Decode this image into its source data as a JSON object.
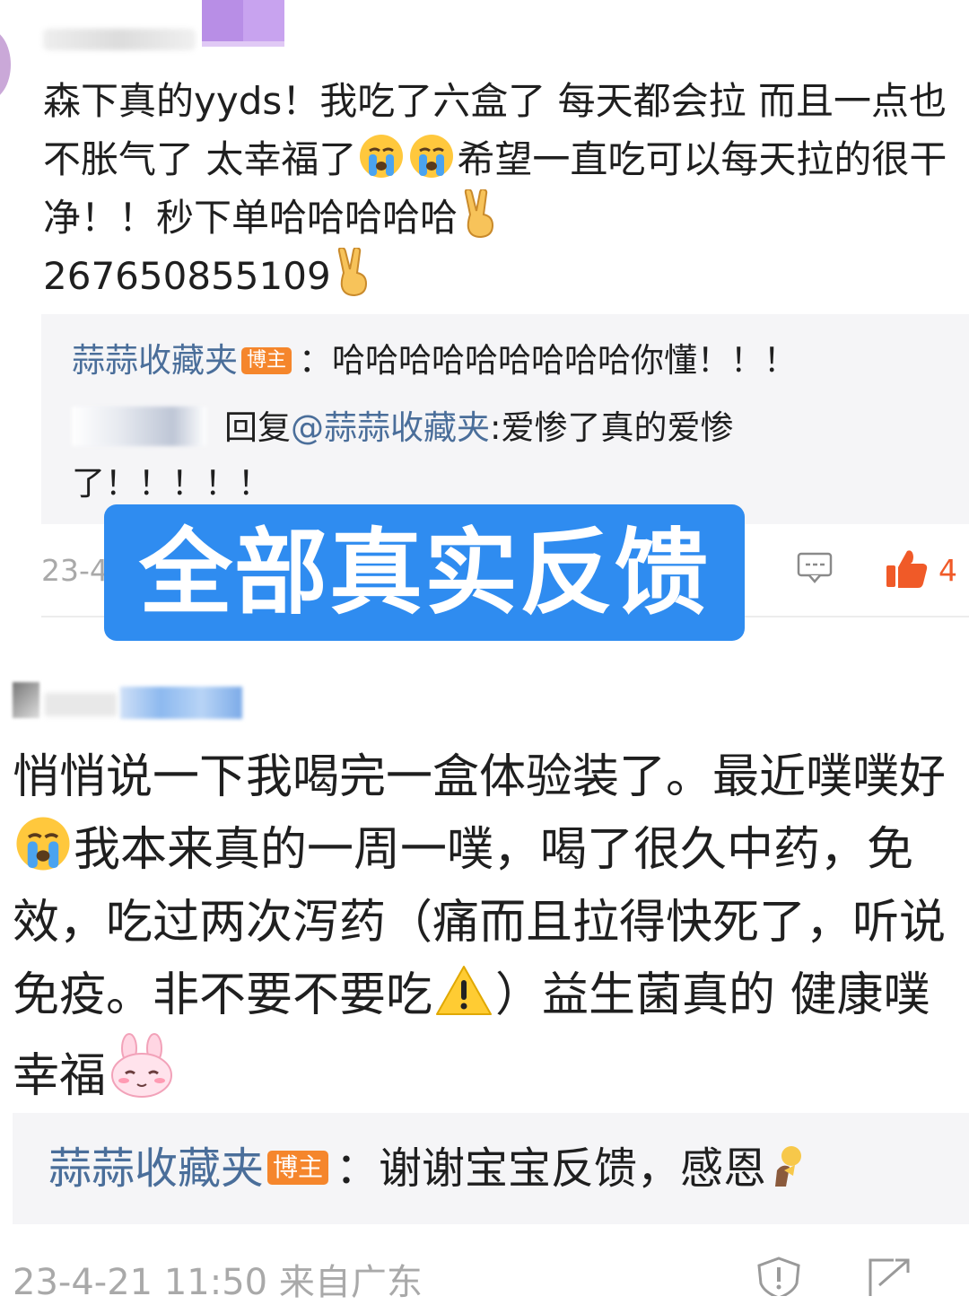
{
  "comment1": {
    "text_part1": "森下真的yyds！我吃了六盒了 每天都会拉 而且一点也不胀气了 太幸福了",
    "text_part2": "希望一直吃可以每天拉的很干净！！秒下单哈哈哈哈哈",
    "order_number": "267650855109",
    "emojis": [
      "crying-emoji",
      "crying-emoji",
      "victory-hand-emoji",
      "victory-hand-emoji"
    ],
    "reply1": {
      "author": "蒜蒜收藏夹",
      "tag": "博主",
      "text": "：哈哈哈哈哈哈哈哈哈你懂！！！"
    },
    "reply2": {
      "prefix": "回复",
      "mention": "@蒜蒜收藏夹",
      "text": ":爱惨了真的爱惨了！！！！！"
    },
    "timestamp": "23-4",
    "like_count": "4"
  },
  "banner": {
    "text": "全部真实反馈",
    "color": "#2f8cf0"
  },
  "comment2": {
    "line1": "悄悄说一下我喝完一盒体验装了。最近噗噗好",
    "line2": "我本来真的一周一噗，喝了很久中药，免",
    "line3": "效，吃过两次泻药（痛而且拉得快死了，听说",
    "line4_a": "免疫。非不要不要吃",
    "line4_b": "）益生菌真的 健康噗",
    "line5": "幸福",
    "emojis": [
      "crying-emoji",
      "warning-emoji",
      "bunny-emoji"
    ],
    "reply": {
      "author": "蒜蒜收藏夹",
      "tag": "博主",
      "text": "：谢谢宝宝反馈，感恩"
    },
    "meta": "23-4-21 11:50  来自广东"
  },
  "colors": {
    "link": "#4a6e9a",
    "tag": "#f5862c",
    "like": "#f05a28",
    "meta": "#a9a9a9",
    "reply_bg": "#f5f5f7"
  }
}
